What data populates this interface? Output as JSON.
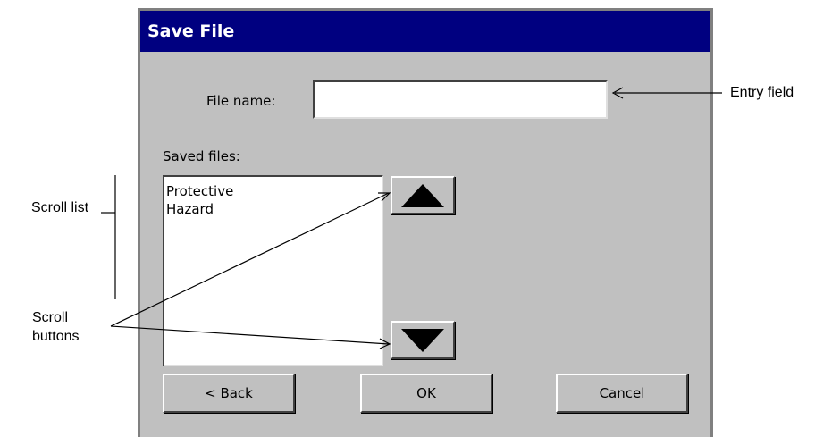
{
  "dialog": {
    "title": "Save File",
    "file_name_label": "File name:",
    "file_name_value": "",
    "saved_files_label": "Saved files:",
    "saved_files": [
      "Protective",
      "Hazard"
    ],
    "scroll_up_icon": "triangle-up-icon",
    "scroll_down_icon": "triangle-down-icon",
    "buttons": {
      "back": "< Back",
      "ok": "OK",
      "cancel": "Cancel"
    }
  },
  "annotations": {
    "entry_field": "Entry field",
    "scroll_list": "Scroll list",
    "scroll_buttons_line1": "Scroll",
    "scroll_buttons_line2": "buttons"
  }
}
